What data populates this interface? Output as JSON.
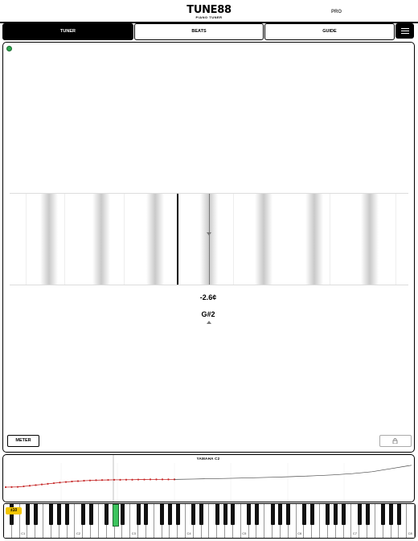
{
  "header": {
    "logo_main": "TUNE88",
    "logo_sub": "PIANO TUNER",
    "edition": "PRO"
  },
  "tabs": [
    {
      "label": "TUNER",
      "active": true
    },
    {
      "label": "BEATS",
      "active": false
    },
    {
      "label": "GUIDE",
      "active": false
    }
  ],
  "menu_icon": "hamburger-menu-icon",
  "tuner": {
    "status": "listening",
    "status_color": "#2fa84f",
    "cents": "-2.6¢",
    "note": "G#2",
    "meter_label": "METER",
    "lock_icon": "lock-icon"
  },
  "graph": {
    "title": "YAMAHA C2"
  },
  "keyboard": {
    "range_badge": "±10",
    "active_key": "G#2",
    "octave_labels": [
      "C1",
      "C2",
      "C3",
      "C4",
      "C5",
      "C6",
      "C7",
      "C8"
    ]
  },
  "chart_data": {
    "type": "line",
    "title": "YAMAHA C2",
    "series": [
      {
        "values": [
          0.0,
          0.1,
          0.2,
          0.6,
          1.1,
          1.6,
          2.1,
          2.6,
          3.1,
          3.6,
          4.0,
          4.4,
          4.7,
          5.0,
          5.2,
          5.4,
          5.5,
          5.6,
          5.7,
          5.7,
          5.8,
          5.8,
          5.9,
          5.9,
          6.0,
          6.0,
          6.0,
          6.0,
          6.0
        ]
      },
      {
        "values": [
          6.0,
          6.3,
          6.6,
          6.9,
          7.3,
          7.7,
          8.2,
          8.8,
          9.5,
          10.5,
          12.0,
          14.5,
          17.0
        ]
      }
    ]
  }
}
